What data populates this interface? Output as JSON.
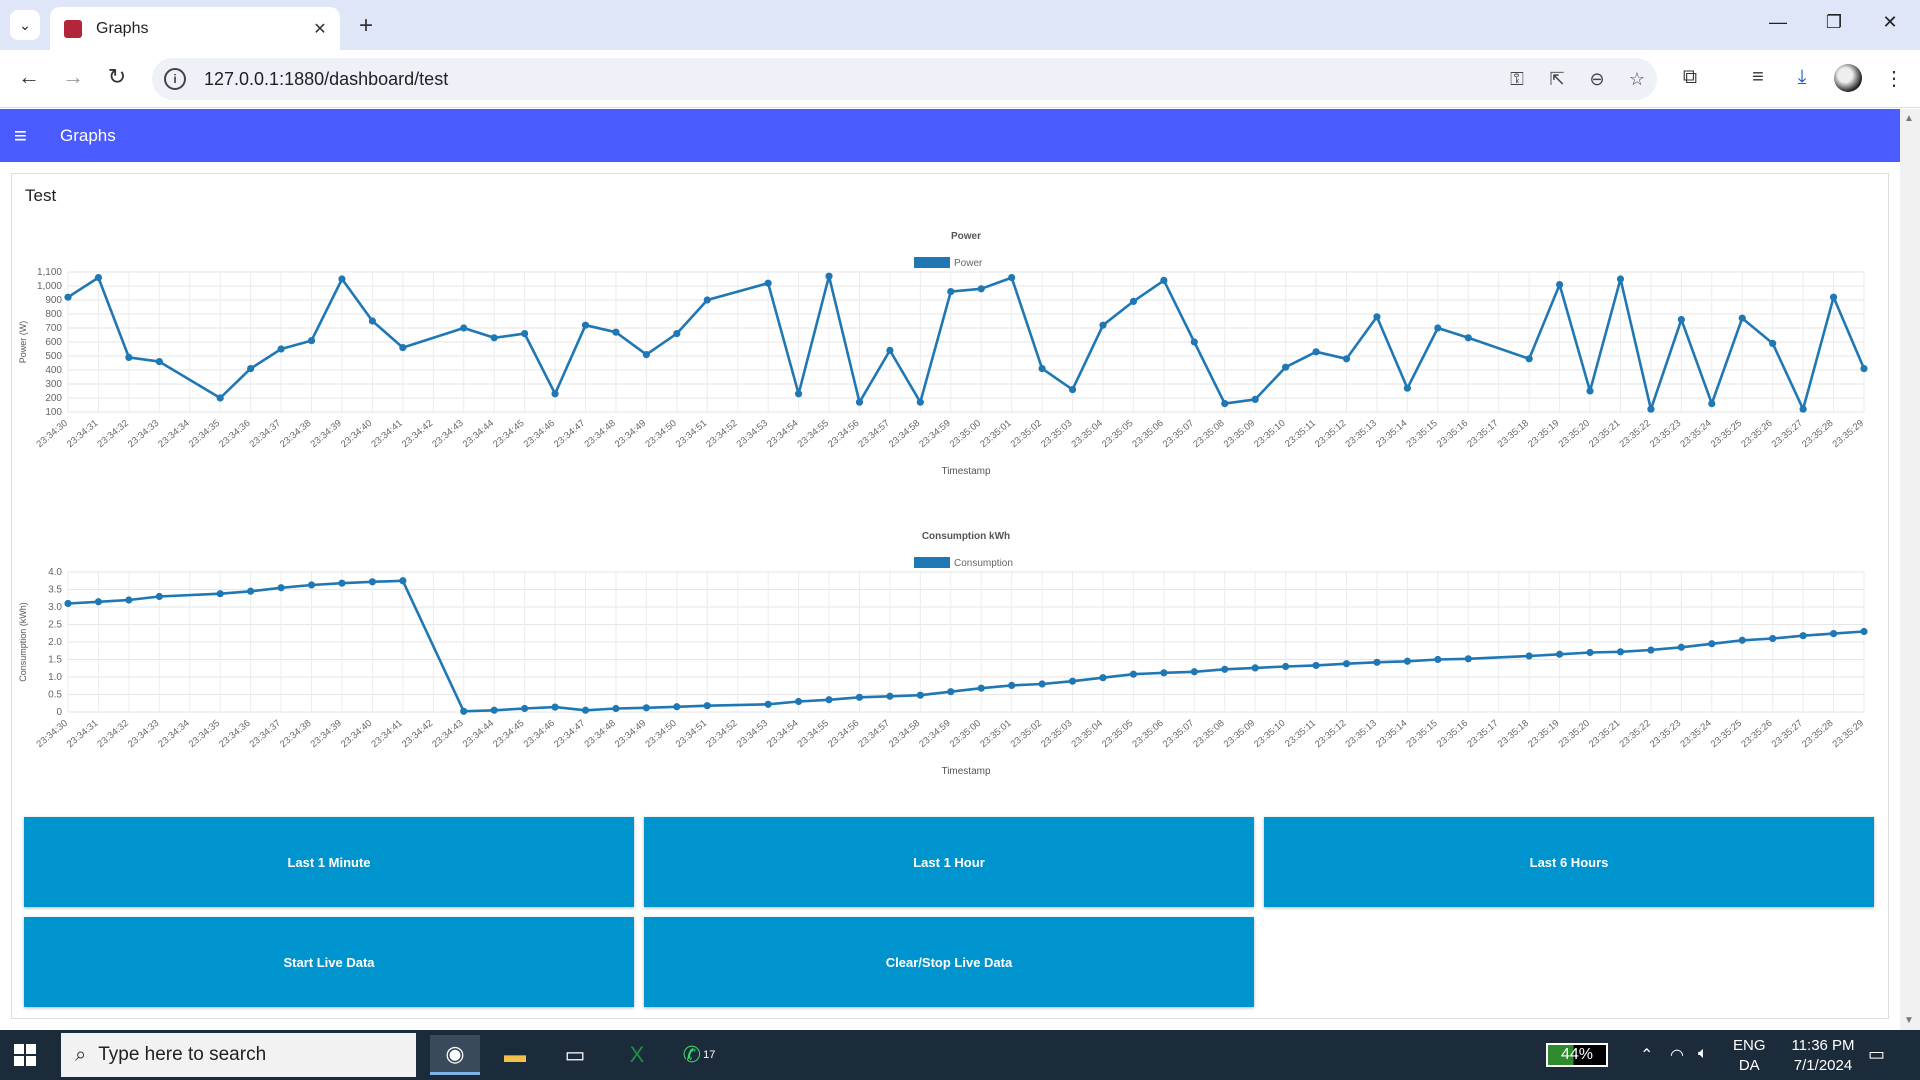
{
  "browser": {
    "tab_title": "Graphs",
    "url": "127.0.0.1:1880/dashboard/test"
  },
  "app": {
    "title": "Graphs",
    "card_title": "Test"
  },
  "buttons": {
    "last_1_minute": "Last 1 Minute",
    "last_1_hour": "Last 1 Hour",
    "last_6_hours": "Last 6 Hours",
    "start_live": "Start Live Data",
    "clear_stop_live": "Clear/Stop Live Data"
  },
  "taskbar": {
    "search_placeholder": "Type here to search",
    "battery": "44%",
    "whatsapp_badge": "17",
    "lang_1": "ENG",
    "lang_2": "DA",
    "time": "11:36 PM",
    "date": "7/1/2024"
  },
  "colors": {
    "accent": "#4a5bff",
    "button": "#0094ce",
    "series": "#1f77b4"
  },
  "chart_data": [
    {
      "type": "line",
      "title": "Power",
      "xlabel": "Timestamp",
      "ylabel": "Power (W)",
      "ylim": [
        100,
        1100
      ],
      "yticks": [
        100,
        200,
        300,
        400,
        500,
        600,
        700,
        800,
        900,
        1000,
        1100
      ],
      "legend": "top-center",
      "grid": true,
      "series": [
        {
          "name": "Power",
          "x": [
            "23:34:30",
            "23:34:31",
            "23:34:32",
            "23:34:33",
            "23:34:34",
            "23:34:35",
            "23:34:36",
            "23:34:37",
            "23:34:38",
            "23:34:39",
            "23:34:40",
            "23:34:41",
            "23:34:42",
            "23:34:43",
            "23:34:44",
            "23:34:45",
            "23:34:46",
            "23:34:47",
            "23:34:48",
            "23:34:49",
            "23:34:50",
            "23:34:51",
            "23:34:52",
            "23:34:53",
            "23:34:54",
            "23:34:55",
            "23:34:56",
            "23:34:57",
            "23:34:58",
            "23:34:59",
            "23:35:00",
            "23:35:01",
            "23:35:02",
            "23:35:03",
            "23:35:04",
            "23:35:05",
            "23:35:06",
            "23:35:07",
            "23:35:08",
            "23:35:09",
            "23:35:10",
            "23:35:11",
            "23:35:12",
            "23:35:13",
            "23:35:14",
            "23:35:15",
            "23:35:16",
            "23:35:17",
            "23:35:18",
            "23:35:19",
            "23:35:20",
            "23:35:21",
            "23:35:22",
            "23:35:23",
            "23:35:24",
            "23:35:25",
            "23:35:26",
            "23:35:27",
            "23:35:28",
            "23:35:29"
          ],
          "values": [
            920,
            1060,
            490,
            460,
            null,
            200,
            410,
            550,
            610,
            1050,
            750,
            560,
            null,
            700,
            630,
            660,
            230,
            720,
            670,
            510,
            660,
            900,
            null,
            1020,
            230,
            1070,
            170,
            540,
            170,
            960,
            980,
            1060,
            410,
            260,
            720,
            890,
            1040,
            600,
            160,
            190,
            420,
            530,
            480,
            780,
            270,
            700,
            630,
            null,
            480,
            1010,
            250,
            1050,
            120,
            760,
            160,
            770,
            590,
            120,
            920,
            410
          ]
        }
      ]
    },
    {
      "type": "line",
      "title": "Consumption kWh",
      "xlabel": "Timestamp",
      "ylabel": "Consumption (kWh)",
      "ylim": [
        0,
        4.0
      ],
      "yticks": [
        0,
        0.5,
        1.0,
        1.5,
        2.0,
        2.5,
        3.0,
        3.5,
        4.0
      ],
      "legend": "top-center",
      "grid": true,
      "series": [
        {
          "name": "Consumption",
          "x": [
            "23:34:30",
            "23:34:31",
            "23:34:32",
            "23:34:33",
            "23:34:34",
            "23:34:35",
            "23:34:36",
            "23:34:37",
            "23:34:38",
            "23:34:39",
            "23:34:40",
            "23:34:41",
            "23:34:42",
            "23:34:43",
            "23:34:44",
            "23:34:45",
            "23:34:46",
            "23:34:47",
            "23:34:48",
            "23:34:49",
            "23:34:50",
            "23:34:51",
            "23:34:52",
            "23:34:53",
            "23:34:54",
            "23:34:55",
            "23:34:56",
            "23:34:57",
            "23:34:58",
            "23:34:59",
            "23:35:00",
            "23:35:01",
            "23:35:02",
            "23:35:03",
            "23:35:04",
            "23:35:05",
            "23:35:06",
            "23:35:07",
            "23:35:08",
            "23:35:09",
            "23:35:10",
            "23:35:11",
            "23:35:12",
            "23:35:13",
            "23:35:14",
            "23:35:15",
            "23:35:16",
            "23:35:17",
            "23:35:18",
            "23:35:19",
            "23:35:20",
            "23:35:21",
            "23:35:22",
            "23:35:23",
            "23:35:24",
            "23:35:25",
            "23:35:26",
            "23:35:27",
            "23:35:28",
            "23:35:29"
          ],
          "values": [
            3.1,
            3.15,
            3.2,
            3.3,
            null,
            3.38,
            3.45,
            3.55,
            3.63,
            3.68,
            3.72,
            3.75,
            null,
            0.02,
            0.05,
            0.1,
            0.14,
            0.05,
            0.1,
            0.12,
            0.15,
            0.18,
            null,
            0.22,
            0.3,
            0.35,
            0.42,
            0.45,
            0.48,
            0.58,
            0.68,
            0.76,
            0.8,
            0.88,
            0.98,
            1.08,
            1.12,
            1.15,
            1.22,
            1.26,
            1.3,
            1.33,
            1.38,
            1.42,
            1.45,
            1.5,
            1.52,
            null,
            1.6,
            1.65,
            1.7,
            1.72,
            1.77,
            1.85,
            1.95,
            2.05,
            2.1,
            2.18,
            2.24,
            2.3
          ]
        }
      ]
    }
  ]
}
